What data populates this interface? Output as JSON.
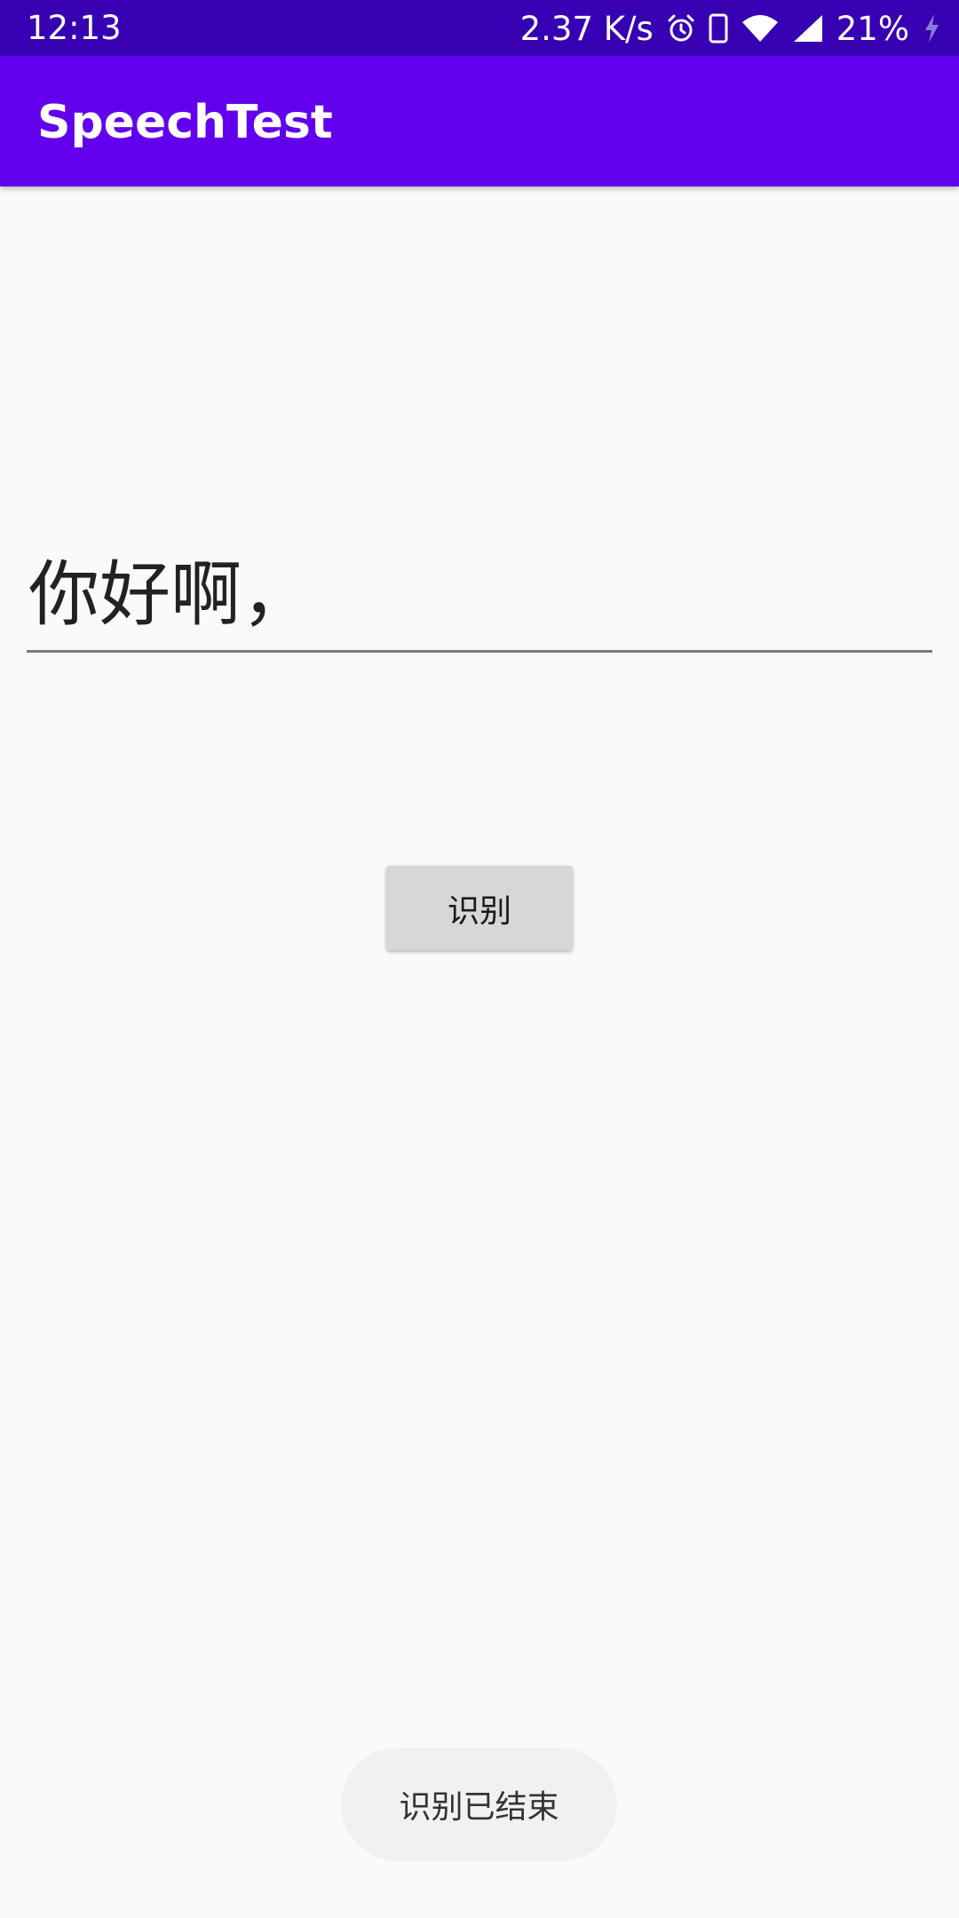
{
  "status_bar": {
    "time": "12:13",
    "network_speed": "2.37 K/s",
    "battery": "21%",
    "icons": [
      "alarm-icon",
      "phone-icon",
      "wifi-icon",
      "signal-icon",
      "charging-icon"
    ],
    "color": "#3700b3"
  },
  "app_bar": {
    "title": "SpeechTest",
    "color": "#6200ee"
  },
  "main": {
    "recognized_text": "你好啊，",
    "recognize_button_label": "识别"
  },
  "toast": {
    "message": "识别已结束"
  }
}
